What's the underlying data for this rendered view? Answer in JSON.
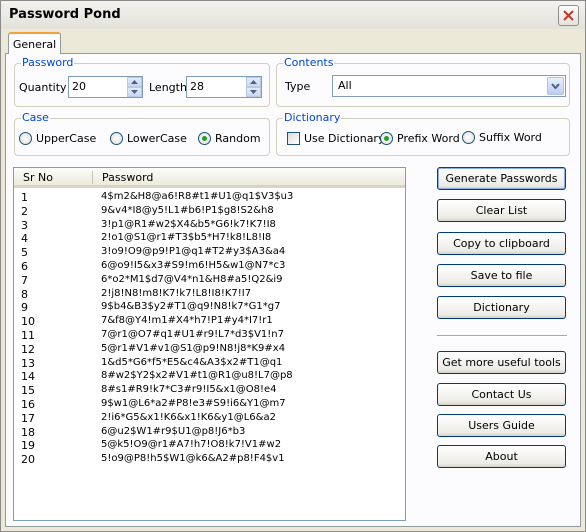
{
  "window": {
    "title": "Password Pond"
  },
  "tabs": [
    {
      "label": "General"
    }
  ],
  "password_group": {
    "label": "Password",
    "quantity_label": "Quantity",
    "quantity_value": "20",
    "length_label": "Length",
    "length_value": "28"
  },
  "contents_group": {
    "label": "Contents",
    "type_label": "Type",
    "type_value": "All"
  },
  "case_group": {
    "label": "Case",
    "options": [
      "UpperCase",
      "LowerCase",
      "Random"
    ],
    "selected": "Random"
  },
  "dictionary_group": {
    "label": "Dictionary",
    "use_dictionary_label": "Use Dictionary",
    "use_dictionary_checked": false,
    "options": [
      "Prefix Word",
      "Suffix Word"
    ],
    "selected": "Prefix Word"
  },
  "list": {
    "columns": [
      "Sr No",
      "Password"
    ],
    "rows": [
      {
        "sr": "1",
        "password": "4$m2&H8@a6!R8#t1#U1@q1$V3$u3"
      },
      {
        "sr": "2",
        "password": "9&v4*I8@y5!L1#b6!P1$g8!S2&h8"
      },
      {
        "sr": "3",
        "password": "3!p1@R1#w2$X4&b5*G6!k7!K7!I8"
      },
      {
        "sr": "4",
        "password": "2!o1@S1@r1#T3$b5*H7!k8!L8!I8"
      },
      {
        "sr": "5",
        "password": "3!o9!O9@p9!P1@q1#T2#y3$A3&a4"
      },
      {
        "sr": "6",
        "password": "6@o9!I5&x3#S9!m6!H5&w1@N7*c3"
      },
      {
        "sr": "7",
        "password": "6*o2*M1$d7@V4*n1&H8#a5!Q2&i9"
      },
      {
        "sr": "8",
        "password": "2!j8!N8!m8!K7!k7!L8!I8!K7!I7"
      },
      {
        "sr": "9",
        "password": "9$b4&B3$y2#T1@q9!N8!k7*G1*g7"
      },
      {
        "sr": "10",
        "password": "7&f8@Y4!m1#X4*h7!P1#y4*I7!r1"
      },
      {
        "sr": "11",
        "password": "7@r1@O7#q1#U1#r9!L7*d3$V1!n7"
      },
      {
        "sr": "12",
        "password": "5@r1#V1#v1@S1@p9!N8!j8*K9#x4"
      },
      {
        "sr": "13",
        "password": "1&d5*G6*f5*E5&c4&A3$x2#T1@q1"
      },
      {
        "sr": "14",
        "password": "8#w2$Y2$x2#V1#t1@R1@u8!L7@p8"
      },
      {
        "sr": "15",
        "password": "8#s1#R9!k7*C3#r9!I5&x1@O8!e4"
      },
      {
        "sr": "16",
        "password": "9$w1@L6*a2#P8!e3#S9!i6&Y1@m7"
      },
      {
        "sr": "17",
        "password": "2!i6*G5&x1!K6&x1!K6&y1@L6&a2"
      },
      {
        "sr": "18",
        "password": "6@u2$W1#r9$U1@p8!J6*b3"
      },
      {
        "sr": "19",
        "password": "5@k5!O9@r1#A7!h7!O8!k7!V1#w2"
      },
      {
        "sr": "20",
        "password": "5!o9@P8!h5$W1@k6&A2#p8!F4$v1"
      }
    ]
  },
  "buttons": {
    "generate": "Generate Passwords",
    "clear": "Clear List",
    "copy": "Copy to clipboard",
    "save": "Save to file",
    "dictionary": "Dictionary",
    "more_tools": "Get more useful tools",
    "contact": "Contact Us",
    "guide": "Users Guide",
    "about": "About"
  }
}
